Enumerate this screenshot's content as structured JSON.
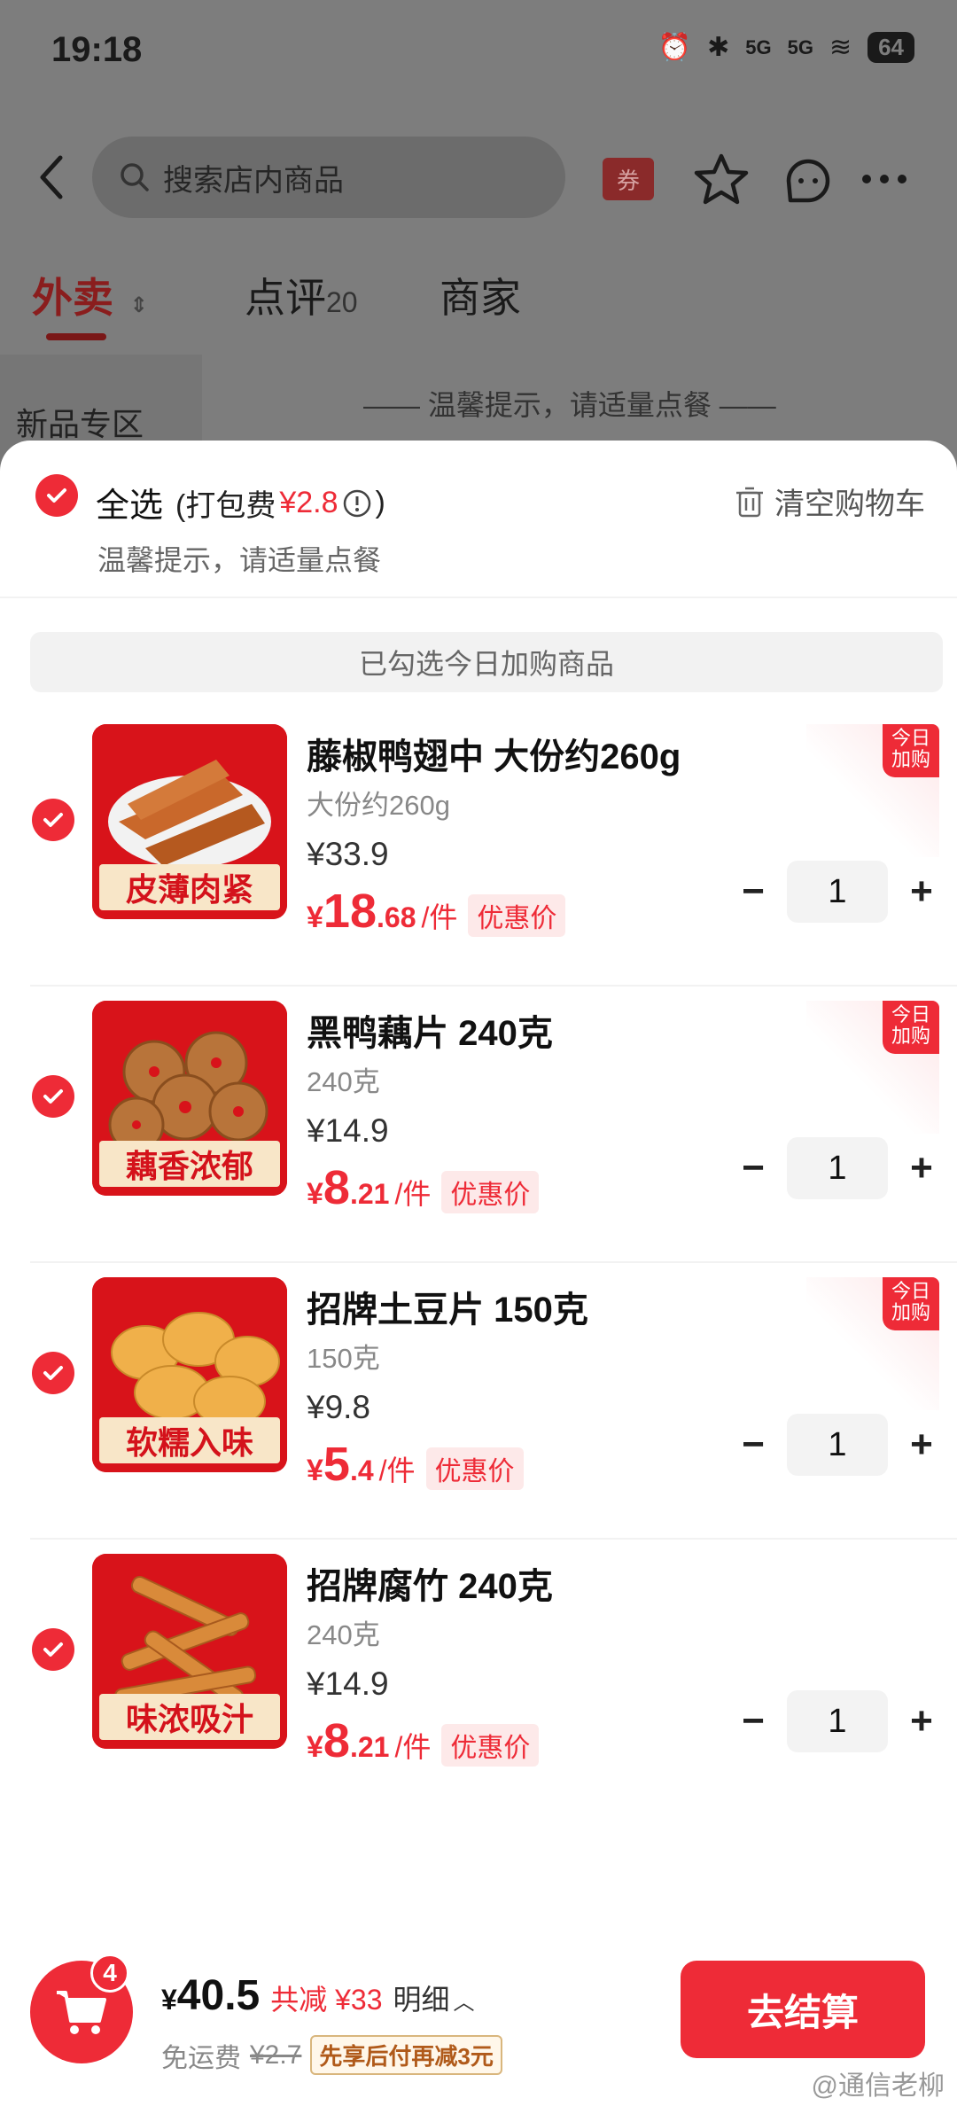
{
  "status_bar": {
    "time": "19:18",
    "network": "5G",
    "battery": "64"
  },
  "top_bar": {
    "search_placeholder": "搜索店内商品",
    "coupon": "券"
  },
  "tabs": [
    {
      "label": "外卖"
    },
    {
      "label": "点评",
      "count": "20"
    },
    {
      "label": "商家"
    }
  ],
  "background": {
    "side_category": "新品专区",
    "tip": "—— 温馨提示，请适量点餐 ——"
  },
  "cart_sheet": {
    "select_all": "全选",
    "packing_fee_label": "(打包费",
    "packing_fee_value": "¥2.8",
    "packing_fee_close": ")",
    "tip": "温馨提示，请适量点餐",
    "clear_cart": "清空购物车",
    "selected_banner": "已勾选今日加购商品"
  },
  "items": [
    {
      "name": "藤椒鸭翅中 大份约260g",
      "spec": "大份约260g",
      "original_price": "¥33.9",
      "deal_currency": "¥",
      "deal_int": "18",
      "deal_dec": ".68",
      "unit": "/件",
      "deal_tag": "优惠价",
      "today_badge": "今日加购",
      "qty": "1",
      "image_caption": "皮薄肉紧",
      "image_color": "#c9682b"
    },
    {
      "name": "黑鸭藕片 240克",
      "spec": "240克",
      "original_price": "¥14.9",
      "deal_currency": "¥",
      "deal_int": "8",
      "deal_dec": ".21",
      "unit": "/件",
      "deal_tag": "优惠价",
      "today_badge": "今日加购",
      "qty": "1",
      "image_caption": "藕香浓郁",
      "image_color": "#b8743a"
    },
    {
      "name": "招牌土豆片 150克",
      "spec": "150克",
      "original_price": "¥9.8",
      "deal_currency": "¥",
      "deal_int": "5",
      "deal_dec": ".4",
      "unit": "/件",
      "deal_tag": "优惠价",
      "today_badge": "今日加购",
      "qty": "1",
      "image_caption": "软糯入味",
      "image_color": "#f0b04a"
    },
    {
      "name": "招牌腐竹 240克",
      "spec": "240克",
      "original_price": "¥14.9",
      "deal_currency": "¥",
      "deal_int": "8",
      "deal_dec": ".21",
      "unit": "/件",
      "deal_tag": "优惠价",
      "qty": "1",
      "image_caption": "味浓吸汁",
      "image_color": "#d98a3a"
    }
  ],
  "bottom_bar": {
    "cart_count": "4",
    "total_currency": "¥",
    "total": "40.5",
    "saved": "共减 ¥33",
    "detail": "明细",
    "delivery_label": "免运费",
    "delivery_original": "¥2.7",
    "promo": "先享后付再减3元",
    "checkout": "去结算"
  },
  "watermark": "@通信老柳",
  "colors": {
    "accent": "#ee2b37",
    "overlay": "#7d7d7d"
  }
}
